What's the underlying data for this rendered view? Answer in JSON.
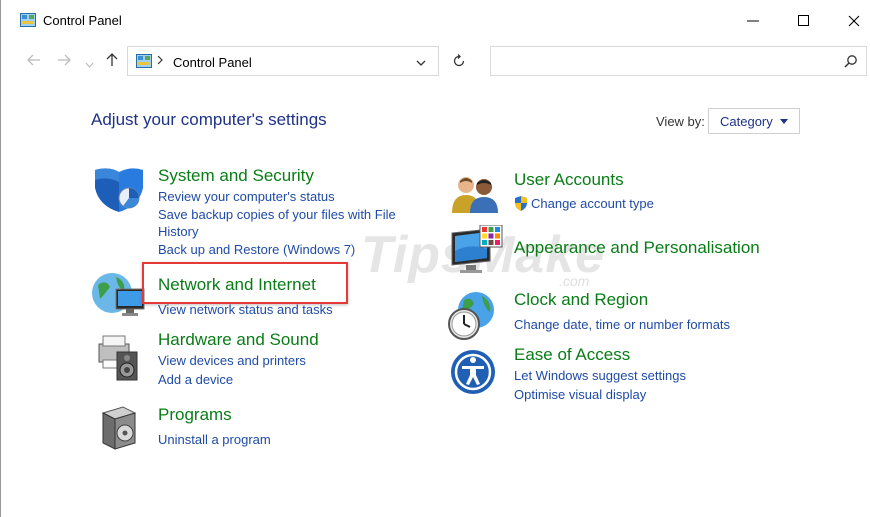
{
  "window": {
    "title": "Control Panel"
  },
  "navbar": {
    "breadcrumb_root": "Control Panel",
    "search_placeholder": ""
  },
  "content": {
    "heading": "Adjust your computer's settings",
    "view_by_label": "View by:",
    "view_by_value": "Category"
  },
  "categories": {
    "system_security": {
      "title": "System and Security",
      "links": [
        "Review your computer's status",
        "Save backup copies of your files with File",
        "History",
        "Back up and Restore (Windows 7)"
      ]
    },
    "network_internet": {
      "title": "Network and Internet",
      "links": [
        "View network status and tasks"
      ]
    },
    "hardware_sound": {
      "title": "Hardware and Sound",
      "links": [
        "View devices and printers",
        "Add a device"
      ]
    },
    "programs": {
      "title": "Programs",
      "links": [
        "Uninstall a program"
      ]
    },
    "user_accounts": {
      "title": "User Accounts",
      "links": [
        "Change account type"
      ]
    },
    "appearance": {
      "title": "Appearance and Personalisation",
      "links": []
    },
    "clock_region": {
      "title": "Clock and Region",
      "links": [
        "Change date, time or number formats"
      ]
    },
    "ease_of_access": {
      "title": "Ease of Access",
      "links": [
        "Let Windows suggest settings",
        "Optimise visual display"
      ]
    }
  },
  "watermark": {
    "text": "TipsMake",
    "suffix": ".com"
  },
  "colors": {
    "category_title": "#0a7c17",
    "link": "#1f4ba5",
    "heading": "#1e3287",
    "highlight_border": "#e53935"
  },
  "icons": {
    "window": "control-panel-icon",
    "system_security": "shield-icon",
    "network_internet": "globe-network-icon",
    "hardware_sound": "printer-speaker-icon",
    "programs": "programs-box-icon",
    "user_accounts": "users-icon",
    "appearance": "monitor-palette-icon",
    "clock_region": "globe-clock-icon",
    "ease_of_access": "ease-of-access-icon"
  }
}
